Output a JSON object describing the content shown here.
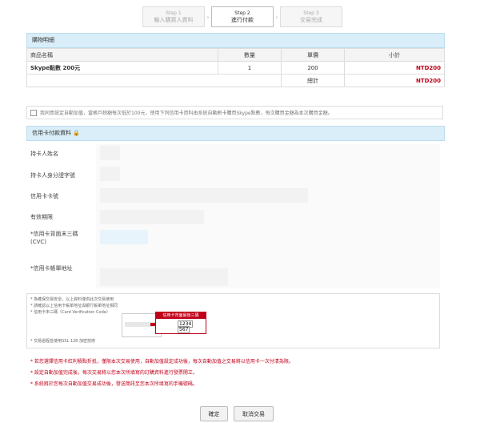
{
  "steps": [
    {
      "num": "Step 1",
      "title": "輸入購買人資料"
    },
    {
      "num": "Step 2",
      "title": "進行付款"
    },
    {
      "num": "Step 3",
      "title": "交易完成"
    }
  ],
  "cart": {
    "title": "購物明細",
    "headers": [
      "商品名稱",
      "數量",
      "單價",
      "小計"
    ],
    "row": {
      "name": "Skype點數 200元",
      "qty": "1",
      "price": "200",
      "subtotal": "NTD200"
    },
    "total_label": "總計",
    "total_value": "NTD200"
  },
  "consent": {
    "text": "我同意設定自動加值，當帳戶餘額每次低於100元，使用下列信用卡資料由系統自動刷卡購買Skype點數，每次購買金額為本次購買金額。"
  },
  "card_form": {
    "title": "信用卡付款資料",
    "labels": [
      "持卡人姓名",
      "持卡人身分證字號",
      "信用卡卡號",
      "有效期限",
      "*信用卡背面末三碼",
      "(CVC)",
      "*信用卡帳單地址"
    ]
  },
  "notes": {
    "lines": [
      "* 為確保交易安全，以上資料僅供此次交易使用",
      "* 請確認以上信用卡帳單地址與銀行帳單地址相同",
      "* 信用卡末三碼（Card Verification Code）",
      "* 交易過程皆使用SSL 128 加密技術"
    ],
    "cvc_label": "信用卡背面最後三碼",
    "cvc_digits": [
      "1234",
      "567"
    ]
  },
  "warnings": [
    "* 若您選擇信用卡紅利積點折抵，僅限本次交易使用，自動加值設定成功後，每次自動加值之交易將以信用卡一次付清為限。",
    "* 設定自動加值完成後，每次交易將以您本次所填寫的訂購資料進行發票開立。",
    "* 系統將於您每次自動加值交易成功後，發送簡訊至您本次所填寫的手機號碼。"
  ],
  "buttons": {
    "confirm": "確定",
    "cancel": "取消交易"
  }
}
